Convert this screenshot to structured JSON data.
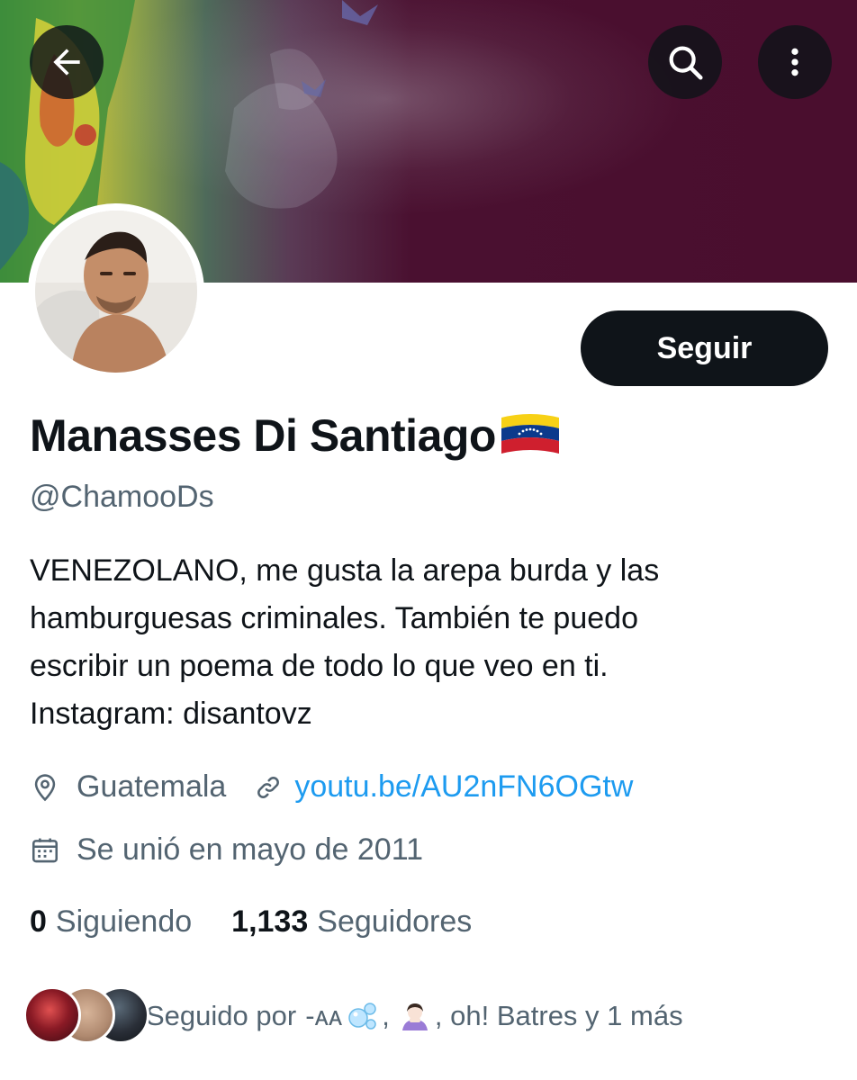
{
  "profile": {
    "display_name": "Manasses Di Santiago",
    "name_emoji": "venezuela-flag",
    "handle": "@ChamooDs",
    "bio_lines": [
      "VENEZOLANO, me gusta la arepa burda y las",
      "hamburguesas criminales. También te puedo",
      "escribir un poema de todo lo que veo en ti.",
      "Instagram: disantovz"
    ],
    "location": "Guatemala",
    "website": "youtu.be/AU2nFN6OGtw",
    "joined": "Se unió en mayo de 2011"
  },
  "actions": {
    "follow_label": "Seguir"
  },
  "stats": {
    "following_count": "0",
    "following_label": "Siguiendo",
    "followers_count": "1,133",
    "followers_label": "Seguidores"
  },
  "followed_by": {
    "prefix": "Seguido por",
    "name1": "-ᴀᴀ",
    "name1_emoji": "bubbles",
    "separator": ",",
    "name2_emoji": "person-bowing",
    "suffix": ", oh! Batres y 1 más"
  },
  "icons": {
    "back": "arrow-left-icon",
    "search": "search-icon",
    "more": "more-vertical-icon",
    "location": "location-pin-icon",
    "link": "link-icon",
    "calendar": "calendar-icon"
  },
  "colors": {
    "text_primary": "#0f1419",
    "text_secondary": "#536471",
    "link": "#1d9bf0",
    "follow_button_bg": "#0f1419",
    "banner_bg": "#4a0e2e"
  }
}
